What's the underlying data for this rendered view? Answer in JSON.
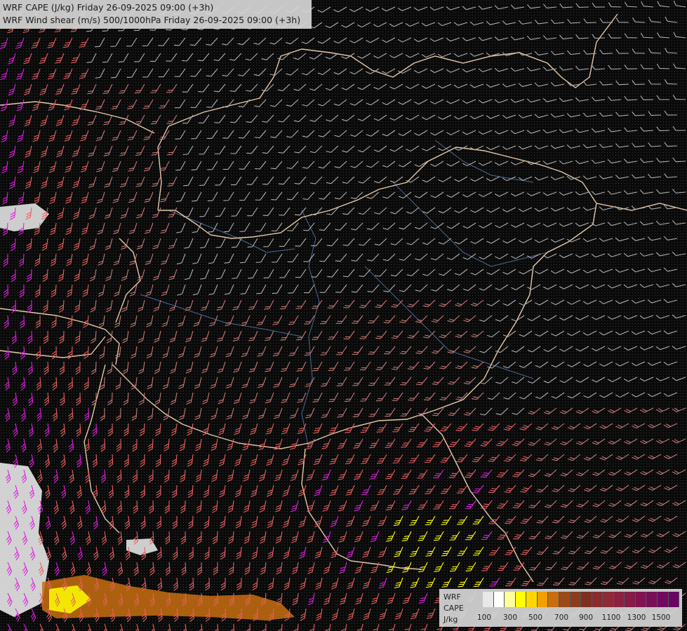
{
  "header": {
    "line1": "WRF CAPE (J/kg) Friday 26-09-2025 09:00 (+3h)",
    "line2": "WRF Wind shear (m/s) 500/1000hPa Friday 26-09-2025 09:00 (+3h)"
  },
  "legend": {
    "model": "WRF",
    "field": "CAPE",
    "unit": "J/kg",
    "ticks": [
      "100",
      "300",
      "500",
      "700",
      "900",
      "1100",
      "1300",
      "1500"
    ],
    "colors": [
      "#e8e8e8",
      "#ffffff",
      "#ffffa0",
      "#ffff00",
      "#ffd700",
      "#f0a000",
      "#c86e10",
      "#9a4a18",
      "#8a3c1c",
      "#7e3020",
      "#8a2a30",
      "#902838",
      "#8c2040",
      "#861a48",
      "#801450",
      "#781058",
      "#700a5e",
      "#680664"
    ]
  },
  "map": {
    "background": "#0a0a0a",
    "border_color": "#e8c8a8",
    "river_color": "#4a6a9a",
    "barb_colors": {
      "low": "#b0b0b0",
      "mid": "#c87878",
      "high": "#e86060",
      "extreme": "#e020e0",
      "cape_high": "#ffff00"
    }
  }
}
